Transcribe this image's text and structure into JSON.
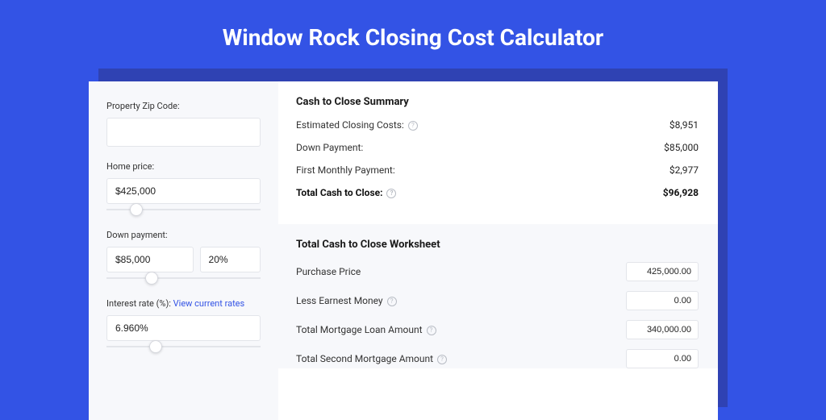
{
  "title": "Window Rock Closing Cost Calculator",
  "sidebar": {
    "zip_label": "Property Zip Code:",
    "zip_value": "",
    "home_price_label": "Home price:",
    "home_price_value": "$425,000",
    "down_payment_label": "Down payment:",
    "down_payment_value": "$85,000",
    "down_payment_pct": "20%",
    "interest_label_prefix": "Interest rate (%): ",
    "interest_link": "View current rates",
    "interest_value": "6.960%"
  },
  "summary": {
    "heading": "Cash to Close Summary",
    "rows": [
      {
        "label": "Estimated Closing Costs:",
        "help": true,
        "value": "$8,951"
      },
      {
        "label": "Down Payment:",
        "help": false,
        "value": "$85,000"
      },
      {
        "label": "First Monthly Payment:",
        "help": false,
        "value": "$2,977"
      }
    ],
    "total": {
      "label": "Total Cash to Close:",
      "help": true,
      "value": "$96,928"
    }
  },
  "worksheet": {
    "heading": "Total Cash to Close Worksheet",
    "rows": [
      {
        "label": "Purchase Price",
        "help": false,
        "value": "425,000.00"
      },
      {
        "label": "Less Earnest Money",
        "help": true,
        "value": "0.00"
      },
      {
        "label": "Total Mortgage Loan Amount",
        "help": true,
        "value": "340,000.00"
      },
      {
        "label": "Total Second Mortgage Amount",
        "help": true,
        "value": "0.00"
      }
    ]
  },
  "slider_positions": {
    "home_price_pct": 15,
    "down_payment_pct": 25,
    "interest_pct": 28
  }
}
